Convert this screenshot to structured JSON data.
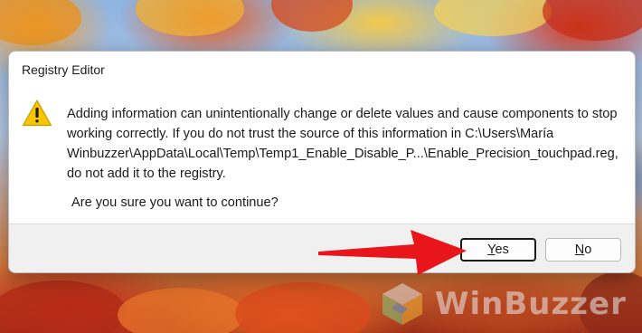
{
  "dialog": {
    "title": "Registry Editor",
    "icon": "warning-icon",
    "message": "Adding information can unintentionally change or delete values and cause components to stop working correctly. If you do not trust the source of this information in C:\\Users\\María Winbuzzer\\AppData\\Local\\Temp\\Temp1_Enable_Disable_P...\\Enable_Precision_touchpad.reg, do not add it to the registry.",
    "question": "Are you sure you want to continue?",
    "buttons": {
      "yes": {
        "mnemonic": "Y",
        "rest": "es"
      },
      "no": {
        "mnemonic": "N",
        "rest": "o"
      }
    }
  },
  "annotation": {
    "icon": "red-arrow-icon",
    "color": "#e8151b"
  },
  "watermark": {
    "text": "WinBuzzer",
    "icon": "winbuzzer-logo-icon"
  },
  "colors": {
    "warning_yellow": "#f7c600",
    "accent": "#e8151b"
  }
}
